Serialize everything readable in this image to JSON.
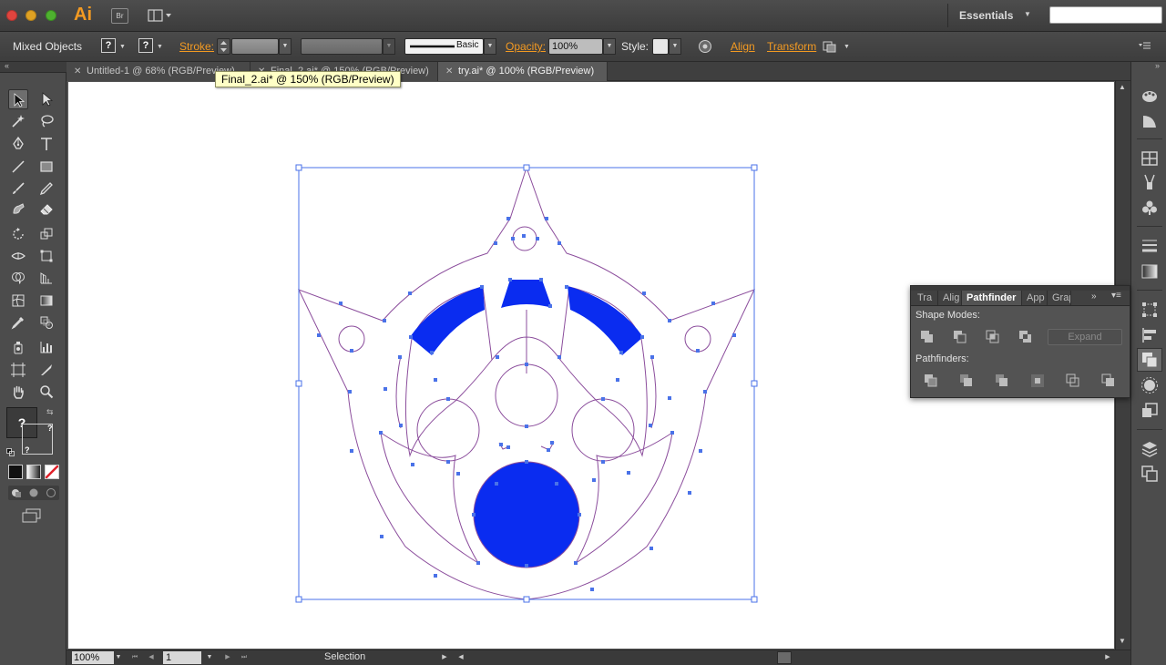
{
  "appbar": {
    "app_logo": "Ai",
    "bridge_label": "Br",
    "workspace": "Essentials",
    "search_placeholder": ""
  },
  "controlbar": {
    "selection_type": "Mixed Objects",
    "fill_unknown": "?",
    "stroke_unknown": "?",
    "stroke_label": "Stroke:",
    "brush_label": "Basic",
    "opacity_label": "Opacity:",
    "opacity_value": "100%",
    "style_label": "Style:",
    "align_label": "Align",
    "transform_label": "Transform"
  },
  "tabs": [
    {
      "label": "Untitled-1 @ 68% (RGB/Preview)",
      "active": false
    },
    {
      "label": "Final_2.ai* @ 150% (RGB/Preview)",
      "active": false
    },
    {
      "label": "try.ai* @ 100% (RGB/Preview)",
      "active": true
    }
  ],
  "tooltip": "Final_2.ai* @ 150% (RGB/Preview)",
  "toolpanel": {
    "fill_stroke_unknown": "?"
  },
  "statusbar": {
    "zoom": "100%",
    "page": "1",
    "current_tool": "Selection"
  },
  "pathfinder": {
    "tabs": [
      "Tra",
      "Alig",
      "Pathfinder",
      "App",
      "Grap"
    ],
    "shape_modes_label": "Shape Modes:",
    "expand_label": "Expand",
    "pathfinders_label": "Pathfinders:"
  },
  "colors": {
    "app_bg": "#535353",
    "accent_orange": "#f39a22",
    "selection_blue": "#4a72e8",
    "art_fill_blue": "#0a2cf0",
    "path_purple": "#8b4d9c"
  }
}
